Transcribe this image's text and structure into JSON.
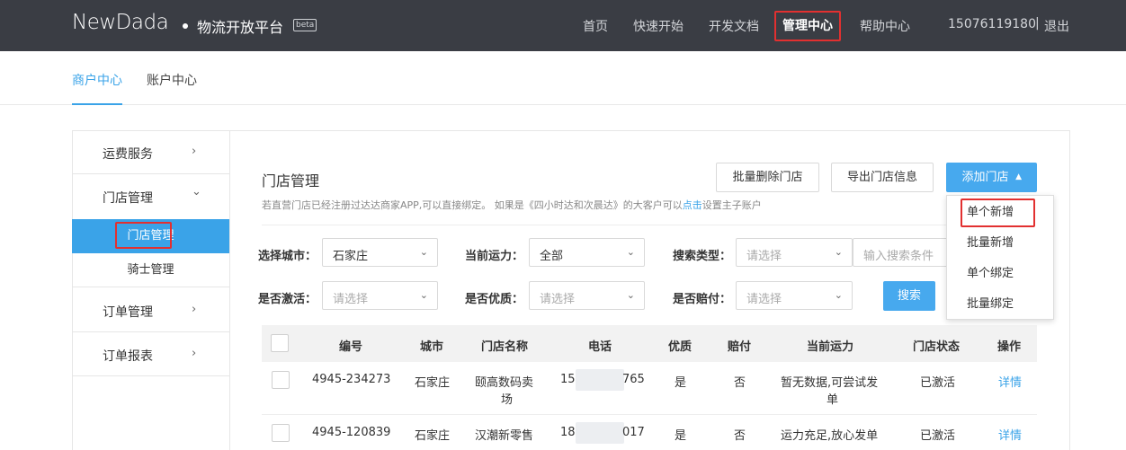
{
  "header": {
    "logo": "NewDada",
    "platform": "物流开放平台",
    "beta": "beta",
    "nav": [
      "首页",
      "快速开始",
      "开发文档",
      "管理中心",
      "帮助中心"
    ],
    "active_nav": "管理中心",
    "phone": "15076119180",
    "separator": "|",
    "logout": "退出"
  },
  "subnav": {
    "tabs": [
      "商户中心",
      "账户中心"
    ]
  },
  "sidebar": {
    "items": [
      {
        "label": "运费服务",
        "chevron": "›"
      },
      {
        "label": "门店管理",
        "chevron": "⌄"
      },
      {
        "label": "订单管理",
        "chevron": "›"
      },
      {
        "label": "订单报表",
        "chevron": "›"
      }
    ],
    "sub_items": [
      "门店管理",
      "骑士管理"
    ]
  },
  "content": {
    "title": "门店管理",
    "hint_prefix": "若直营门店已经注册过达达商家APP,可以直接绑定。 如果是《四小时达和次晨达》的大客户可以",
    "hint_link": "点击",
    "hint_suffix": "设置主子账户",
    "buttons": {
      "batch_delete": "批量删除门店",
      "export": "导出门店信息",
      "add": "添加门店",
      "search": "搜索"
    }
  },
  "dropdown": {
    "items": [
      "单个新增",
      "批量新增",
      "单个绑定",
      "批量绑定"
    ]
  },
  "filters": {
    "city_label": "选择城市：",
    "city_value": "石家庄",
    "capacity_label": "当前运力：",
    "capacity_value": "全部",
    "search_type_label": "搜索类型：",
    "search_type_placeholder": "请选择",
    "search_input_placeholder": "输入搜索条件",
    "active_label": "是否激活：",
    "active_placeholder": "请选择",
    "quality_label": "是否优质：",
    "quality_placeholder": "请选择",
    "compensate_label": "是否赔付：",
    "compensate_placeholder": "请选择"
  },
  "table": {
    "columns": [
      "编号",
      "城市",
      "门店名称",
      "电话",
      "优质",
      "赔付",
      "当前运力",
      "门店状态",
      "操作"
    ],
    "rows": [
      {
        "id": "4945-234273",
        "city": "石家庄",
        "name_l1": "颐高数码卖",
        "name_l2": "场",
        "phone_a": "15",
        "phone_b": "765",
        "quality": "是",
        "comp": "否",
        "cap_l1": "暂无数据,可尝试发",
        "cap_l2": "单",
        "status": "已激活",
        "action": "详情"
      },
      {
        "id": "4945-120839",
        "city": "石家庄",
        "name_l1": "汉潮新零售",
        "name_l2": "",
        "phone_a": "18",
        "phone_b": "017",
        "quality": "是",
        "comp": "否",
        "cap_l1": "运力充足,放心发单",
        "cap_l2": "",
        "status": "已激活",
        "action": "详情"
      }
    ]
  },
  "colors": {
    "topbar": "#3a3d44",
    "accent": "#3aa3e8",
    "highlight": "#e23030"
  }
}
